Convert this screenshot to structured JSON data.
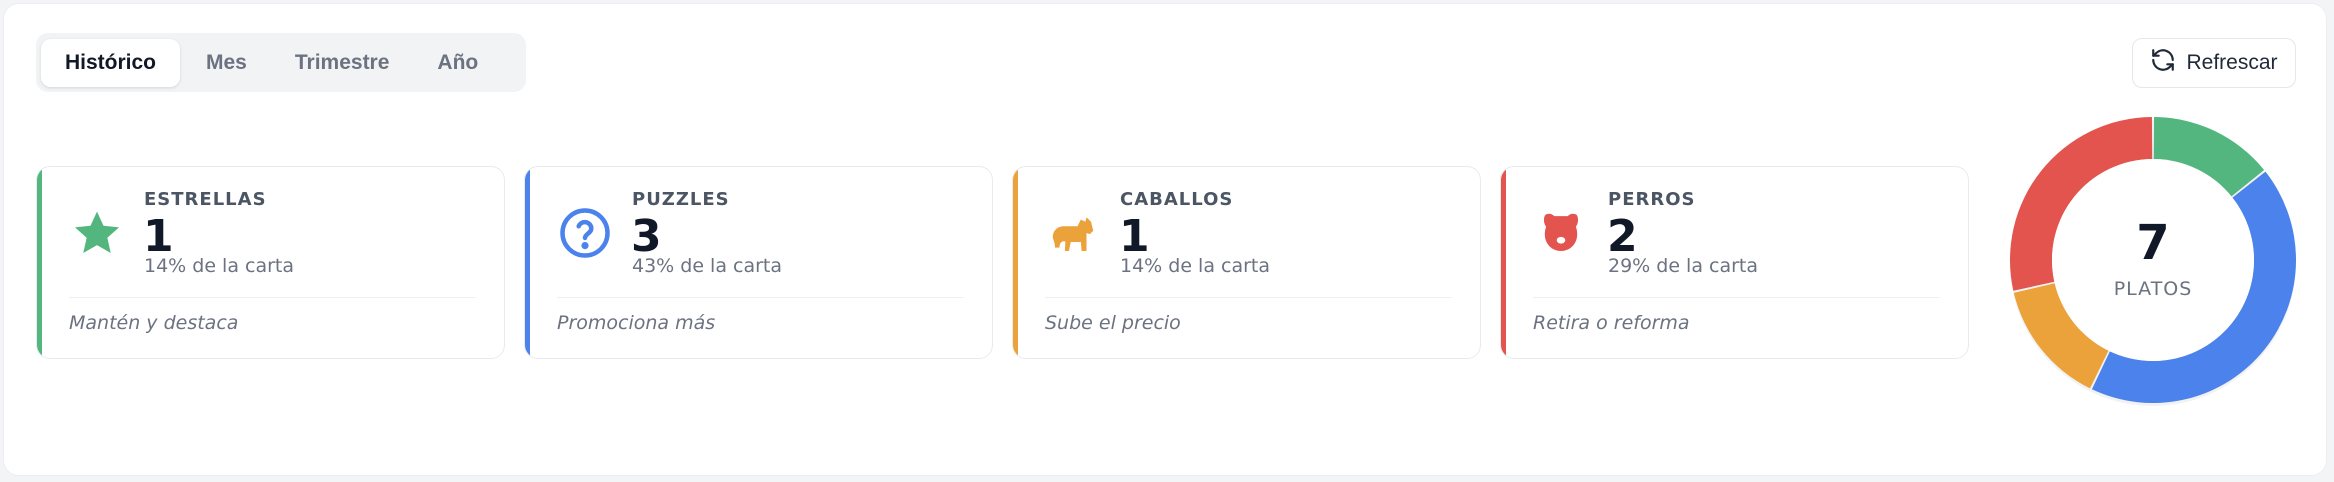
{
  "tabs": [
    {
      "label": "Histórico",
      "active": true
    },
    {
      "label": "Mes",
      "active": false
    },
    {
      "label": "Trimestre",
      "active": false
    },
    {
      "label": "Año",
      "active": false
    }
  ],
  "refresh": {
    "label": "Refrescar",
    "icon": "refresh-icon"
  },
  "cards": [
    {
      "label": "ESTRELLAS",
      "count": "1",
      "pct": "14% de la carta",
      "action": "Mantén y destaca",
      "color": "#52b67e",
      "icon": "star-icon"
    },
    {
      "label": "PUZZLES",
      "count": "3",
      "pct": "43% de la carta",
      "action": "Promociona más",
      "color": "#4b82ec",
      "icon": "question-circle-icon"
    },
    {
      "label": "CABALLOS",
      "count": "1",
      "pct": "14% de la carta",
      "action": "Sube el precio",
      "color": "#eba23a",
      "icon": "horse-icon"
    },
    {
      "label": "PERROS",
      "count": "2",
      "pct": "29% de la carta",
      "action": "Retira o reforma",
      "color": "#e2544d",
      "icon": "dog-icon"
    }
  ],
  "donut": {
    "total": "7",
    "label": "PLATOS",
    "segments": [
      {
        "name": "ESTRELLAS",
        "value": 1,
        "color": "#52b67e"
      },
      {
        "name": "PUZZLES",
        "value": 3,
        "color": "#4b82ec"
      },
      {
        "name": "CABALLOS",
        "value": 1,
        "color": "#eba23a"
      },
      {
        "name": "PERROS",
        "value": 2,
        "color": "#e2544d"
      }
    ]
  }
}
